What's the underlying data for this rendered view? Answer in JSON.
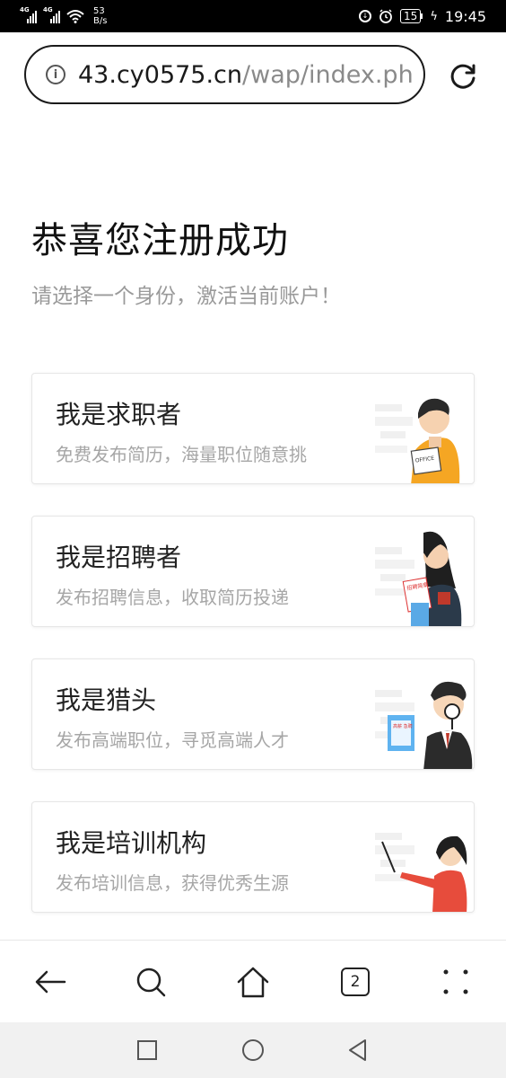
{
  "status_bar": {
    "network_1": "4G",
    "network_2": "4G",
    "speed_value": "53",
    "speed_unit": "B/s",
    "battery": "15",
    "time": "19:45"
  },
  "address_bar": {
    "url_host": "43.cy0575.cn",
    "url_path": "/wap/index.ph"
  },
  "page": {
    "title": "恭喜您注册成功",
    "subtitle": "请选择一个身份，激活当前账户！"
  },
  "roles": [
    {
      "title": "我是求职者",
      "desc": "免费发布简历，海量职位随意挑",
      "illustration_text": "OFFICE"
    },
    {
      "title": "我是招聘者",
      "desc": "发布招聘信息，收取简历投递",
      "illustration_text": "招聘简章"
    },
    {
      "title": "我是猎头",
      "desc": "发布高端职位，寻觅高端人才",
      "illustration_text": "高薪 急聘"
    },
    {
      "title": "我是培训机构",
      "desc": "发布培训信息，获得优秀生源",
      "illustration_text": ""
    }
  ],
  "toolbar": {
    "tab_count": "2"
  },
  "colors": {
    "title": "#111111",
    "subtitle": "#9a9a9a",
    "card_border": "#e6e6e6",
    "navbar_bg": "#f1f1f1"
  }
}
